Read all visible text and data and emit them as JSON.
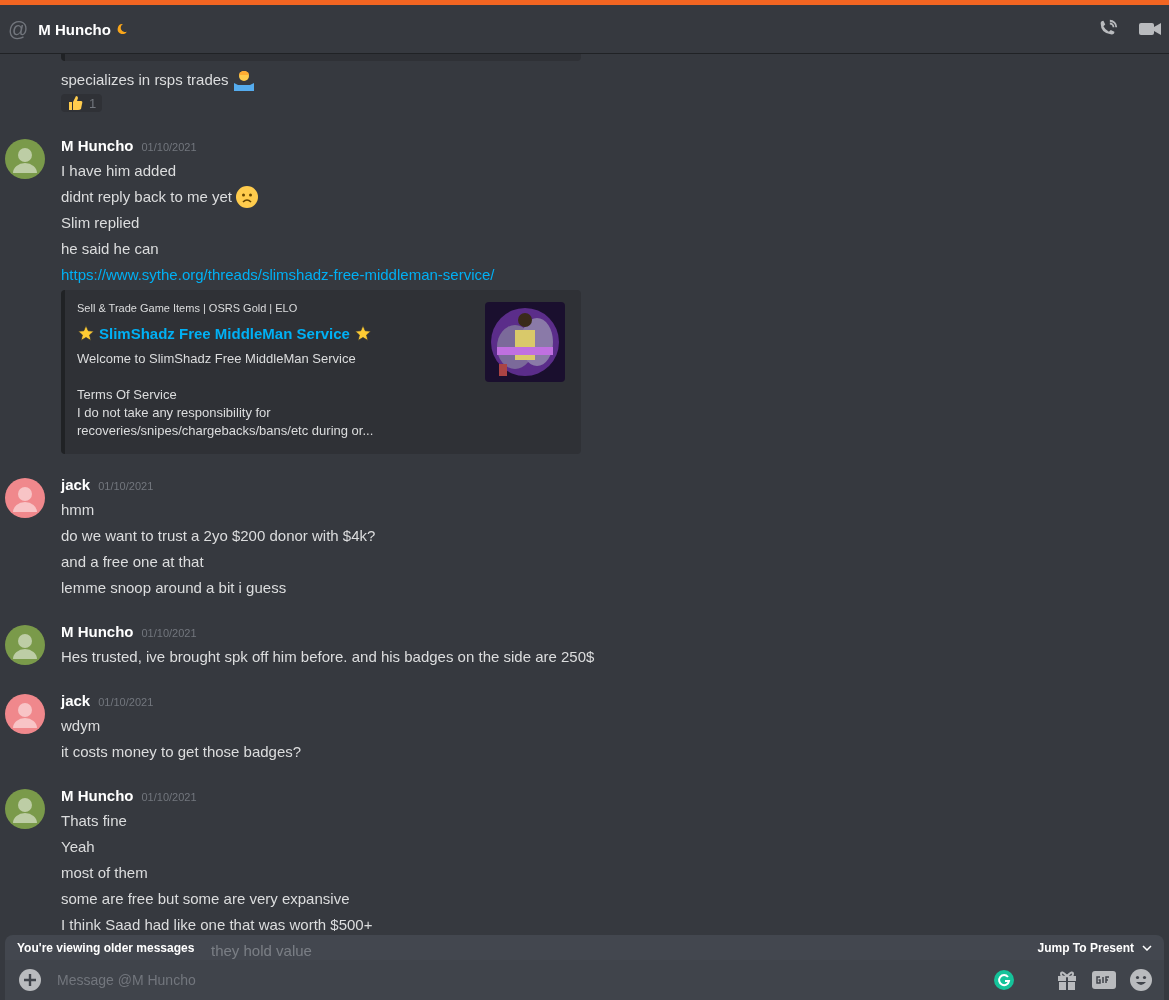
{
  "header": {
    "prefix": "@",
    "title": "M Huncho",
    "idle": true
  },
  "top_message": {
    "text": "specializes in rsps trades",
    "reaction": {
      "count": "1"
    }
  },
  "messages": [
    {
      "author": "M Huncho",
      "color": "#7a9a4a",
      "timestamp": "01/10/2021",
      "lines": [
        {
          "kind": "text",
          "text": "I have him added"
        },
        {
          "kind": "emoji_text",
          "text": "didnt reply back to me yet"
        },
        {
          "kind": "text",
          "text": "Slim replied"
        },
        {
          "kind": "text",
          "text": "he said he can"
        },
        {
          "kind": "link",
          "text": "https://www.sythe.org/threads/slimshadz-free-middleman-service/"
        },
        {
          "kind": "embed",
          "provider": "Sell & Trade Game Items | OSRS Gold | ELO",
          "title": "SlimShadz Free MiddleMan Service",
          "description": [
            [
              "Welcome to SlimShadz Free MiddleMan Service"
            ],
            [
              "Terms Of Service",
              "I do not take any responsibility for",
              "recoveries/snipes/chargebacks/bans/etc during or..."
            ]
          ]
        }
      ]
    },
    {
      "author": "jack",
      "color": "#f0888c",
      "timestamp": "01/10/2021",
      "lines": [
        {
          "kind": "text",
          "text": "hmm"
        },
        {
          "kind": "text",
          "text": "do we want to trust a 2yo $200 donor with $4k?"
        },
        {
          "kind": "text",
          "text": "and a free one at that"
        },
        {
          "kind": "text",
          "text": "lemme snoop around a bit i guess"
        }
      ]
    },
    {
      "author": "M Huncho",
      "color": "#7a9a4a",
      "timestamp": "01/10/2021",
      "lines": [
        {
          "kind": "text",
          "text": "Hes trusted, ive brought spk off him before.  and his badges on the side are 250$"
        }
      ]
    },
    {
      "author": "jack",
      "color": "#f0888c",
      "timestamp": "01/10/2021",
      "lines": [
        {
          "kind": "text",
          "text": "wdym"
        },
        {
          "kind": "text",
          "text": "it costs money to get those badges?"
        }
      ]
    },
    {
      "author": "M Huncho",
      "color": "#7a9a4a",
      "timestamp": "01/10/2021",
      "lines": [
        {
          "kind": "text",
          "text": "Thats fine"
        },
        {
          "kind": "text",
          "text": "Yeah"
        },
        {
          "kind": "text",
          "text": "most of them"
        },
        {
          "kind": "text",
          "text": "some are free but some are very expansive"
        },
        {
          "kind": "text",
          "text": "I think Saad had like one that was worth $500+"
        },
        {
          "kind": "hidden",
          "text": "they hold value"
        }
      ]
    }
  ],
  "older_banner": {
    "text": "You're viewing older messages",
    "action": "Jump To Present"
  },
  "composer": {
    "placeholder": "Message @M Huncho"
  }
}
